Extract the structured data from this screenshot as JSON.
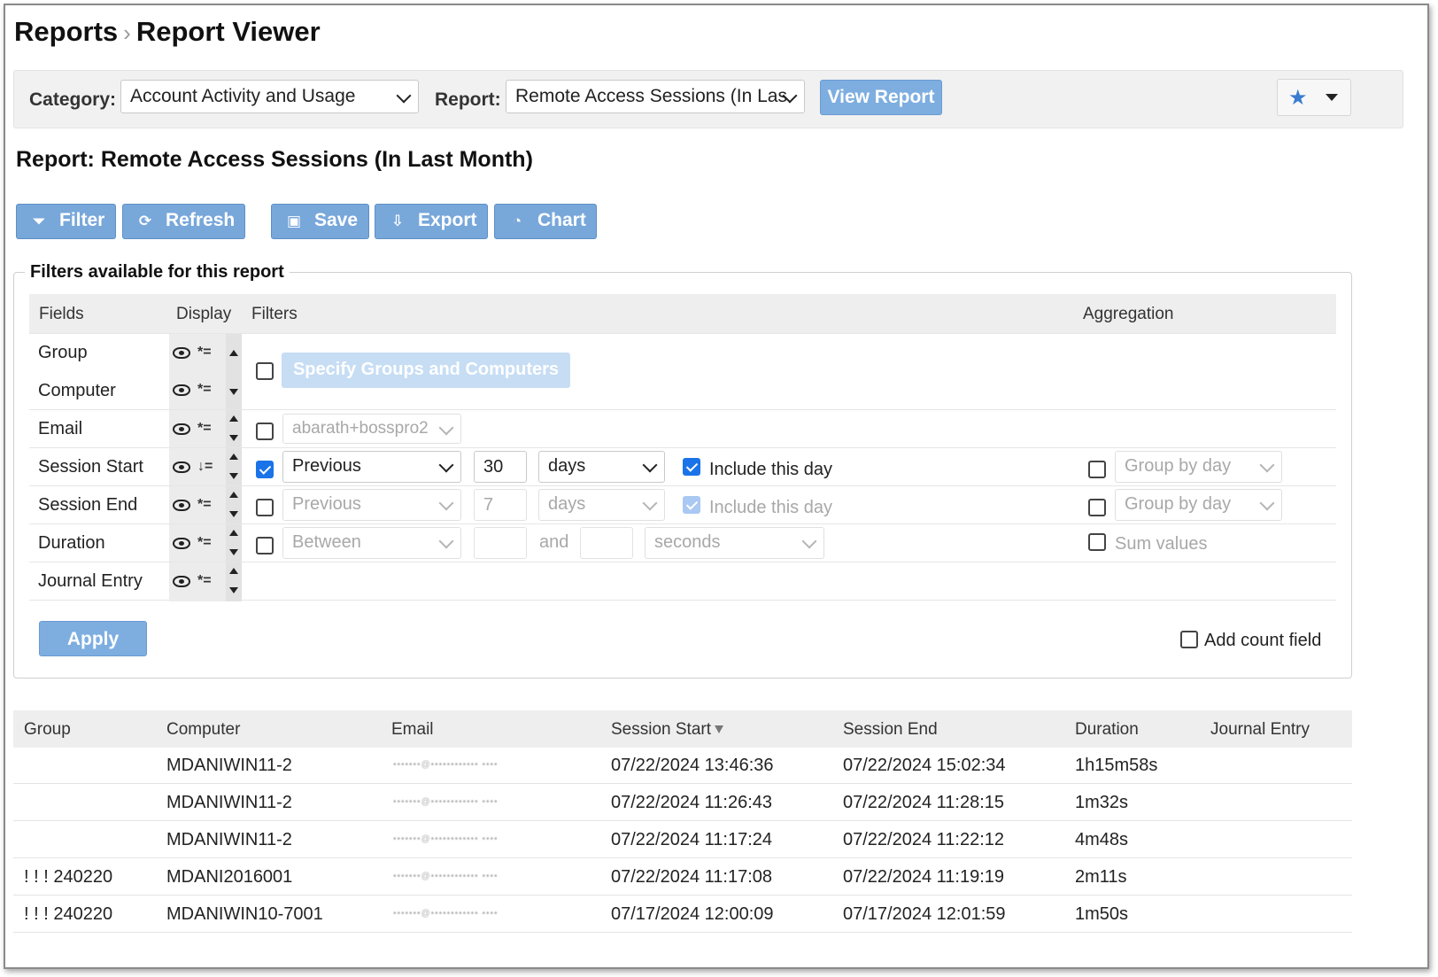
{
  "breadcrumb": {
    "root": "Reports",
    "separator": "›",
    "current": "Report Viewer"
  },
  "topbar": {
    "category_label": "Category:",
    "category_value": "Account Activity and Usage",
    "report_label": "Report:",
    "report_value": "Remote Access Sessions (In Las",
    "view_report": "View Report",
    "favorite_icon": "star-icon"
  },
  "report_title": "Report: Remote Access Sessions (In Last Month)",
  "toolbar": {
    "filter": "Filter",
    "refresh": "Refresh",
    "save": "Save",
    "export": "Export",
    "chart": "Chart"
  },
  "filters_panel": {
    "legend": "Filters available for this report",
    "headers": {
      "fields": "Fields",
      "display": "Display",
      "filters": "Filters",
      "aggregation": "Aggregation"
    },
    "fields": {
      "group": "Group",
      "computer": "Computer",
      "email": "Email",
      "session_start": "Session Start",
      "session_end": "Session End",
      "duration": "Duration",
      "journal_entry": "Journal Entry"
    },
    "specify_button": "Specify Groups and Computers",
    "email_value": "abarath+bosspro2",
    "session_start": {
      "mode": "Previous",
      "count": "30",
      "unit": "days",
      "include_label": "Include this day",
      "group_by": "Group by day"
    },
    "session_end": {
      "mode": "Previous",
      "count": "7",
      "unit": "days",
      "include_label": "Include this day",
      "group_by": "Group by day"
    },
    "duration": {
      "mode": "Between",
      "and_label": "and",
      "unit": "seconds",
      "sum_label": "Sum values"
    },
    "apply": "Apply",
    "add_count": "Add count field"
  },
  "results": {
    "headers": {
      "group": "Group",
      "computer": "Computer",
      "email": "Email",
      "session_start": "Session Start",
      "session_end": "Session End",
      "duration": "Duration",
      "journal_entry": "Journal Entry"
    },
    "rows": [
      {
        "group": "",
        "computer": "MDANIWIN11-2",
        "email": "•••••••@•••••••••••• ••••",
        "start": "07/22/2024 13:46:36",
        "end": "07/22/2024 15:02:34",
        "duration": "1h15m58s",
        "journal": ""
      },
      {
        "group": "",
        "computer": "MDANIWIN11-2",
        "email": "•••••••@•••••••••••• ••••",
        "start": "07/22/2024 11:26:43",
        "end": "07/22/2024 11:28:15",
        "duration": "1m32s",
        "journal": ""
      },
      {
        "group": "",
        "computer": "MDANIWIN11-2",
        "email": "•••••••@•••••••••••• ••••",
        "start": "07/22/2024 11:17:24",
        "end": "07/22/2024 11:22:12",
        "duration": "4m48s",
        "journal": ""
      },
      {
        "group": "! ! ! 240220",
        "computer": "MDANI2016001",
        "email": "•••••••@•••••••••••• ••••",
        "start": "07/22/2024 11:17:08",
        "end": "07/22/2024 11:19:19",
        "duration": "2m11s",
        "journal": ""
      },
      {
        "group": "! ! ! 240220",
        "computer": "MDANIWIN10-7001",
        "email": "•••••••@•••••••••••• ••••",
        "start": "07/17/2024 12:00:09",
        "end": "07/17/2024 12:01:59",
        "duration": "1m50s",
        "journal": ""
      }
    ]
  }
}
